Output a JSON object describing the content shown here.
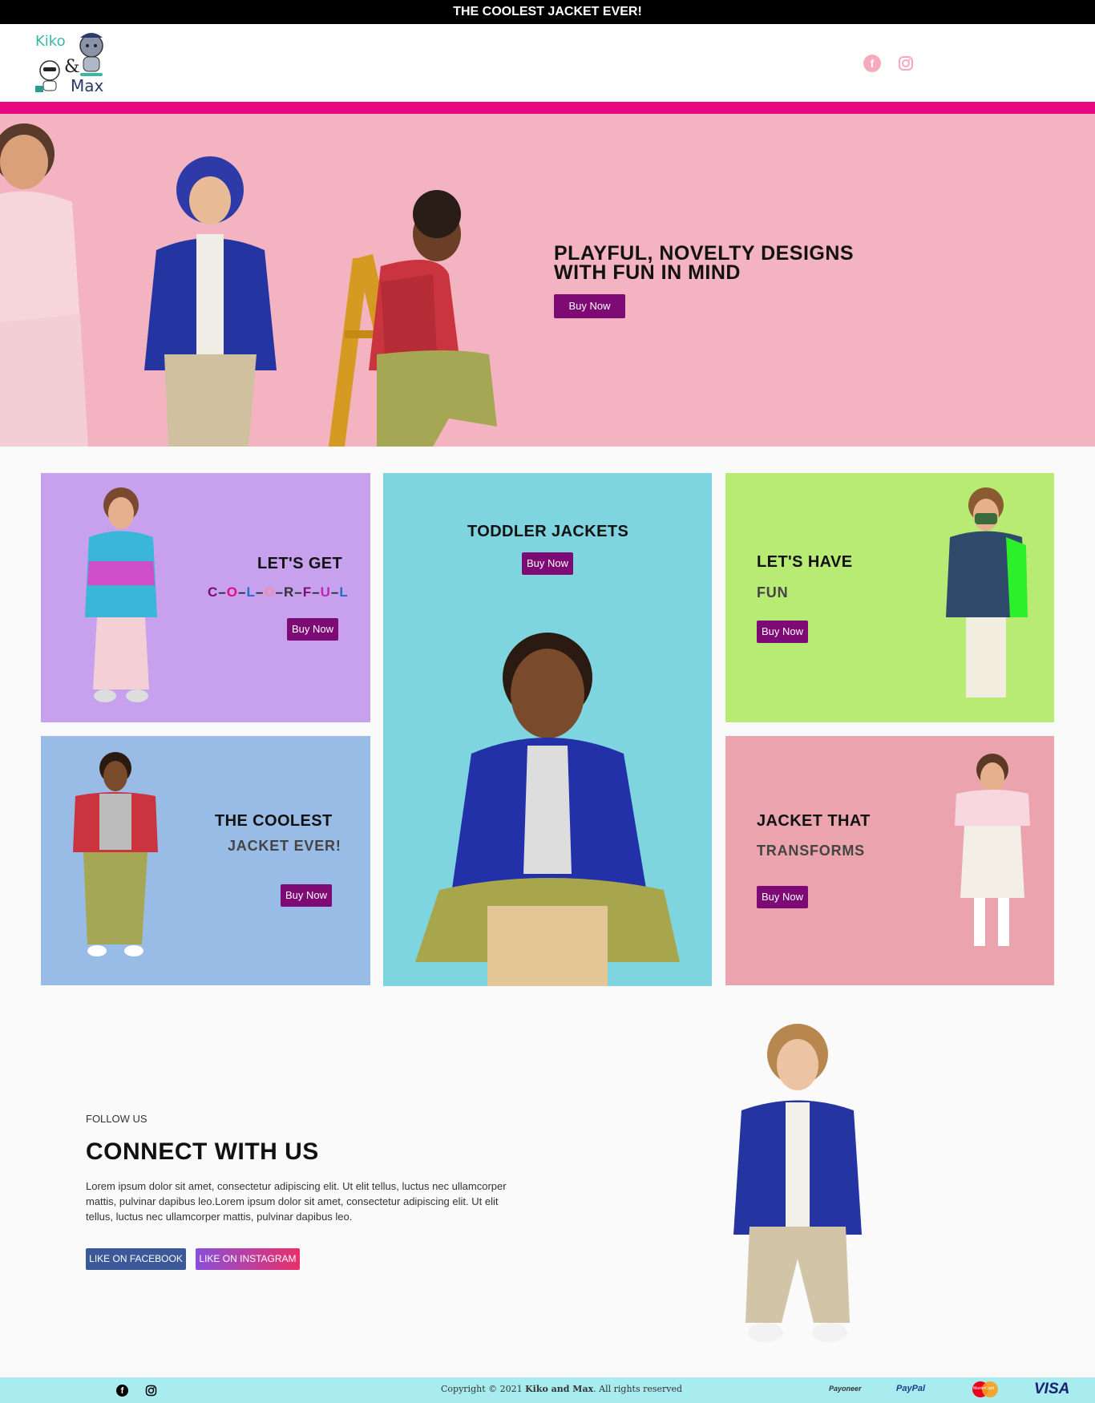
{
  "topbar": {
    "text": "THE COOLEST JACKET EVER!"
  },
  "header": {
    "logo_text": [
      "Kiko",
      "&",
      "Max"
    ],
    "social": [
      {
        "icon": "facebook-icon",
        "color": "#f9a9bd"
      },
      {
        "icon": "instagram-icon",
        "color": "#f9a9bd"
      }
    ]
  },
  "hero": {
    "title_line1": "PLAYFUL, NOVELTY DESIGNS",
    "title_line2": "WITH FUN IN MIND",
    "button": "Buy Now",
    "background": "#f4b3c1"
  },
  "cards": {
    "colorful": {
      "title": "LET'S GET",
      "letters": [
        "C",
        "–",
        "O",
        "–",
        "L",
        "–",
        "O",
        "–",
        "R",
        "–",
        "F",
        "–",
        "U",
        "–",
        "L"
      ],
      "button": "Buy Now",
      "background": "#c7a0ee"
    },
    "toddler": {
      "title": "TODDLER JACKETS",
      "button": "Buy Now",
      "background": "#7ed5df"
    },
    "fun": {
      "title": "LET'S HAVE",
      "subtitle": "FUN",
      "button": "Buy Now",
      "background": "#b8eb73"
    },
    "coolest": {
      "title": "THE COOLEST",
      "subtitle": "JACKET EVER!",
      "button": "Buy Now",
      "background": "#99bce6"
    },
    "transforms": {
      "title": "JACKET THAT",
      "subtitle": "TRANSFORMS",
      "button": "Buy Now",
      "background": "#eba4ad"
    }
  },
  "connect": {
    "eyebrow": "FOLLOW US",
    "title": "CONNECT WITH US",
    "body": "Lorem ipsum dolor sit amet, consectetur adipiscing elit. Ut elit tellus, luctus nec ullamcorper mattis, pulvinar dapibus leo.Lorem ipsum dolor sit amet, consectetur adipiscing elit. Ut elit tellus, luctus nec ullamcorper mattis, pulvinar dapibus leo.",
    "facebook_button": "LIKE ON FACEBOOK",
    "instagram_button": "LIKE ON INSTAGRAM"
  },
  "footer": {
    "copyright_prefix": "Copyright © 2021 ",
    "brand": "Kiko and Max",
    "copyright_suffix": ". All rights reserved",
    "payments": [
      "Payoneer",
      "PayPal",
      "MasterCard",
      "VISA"
    ]
  },
  "colors": {
    "accent": "#7d0a75",
    "brand_pink": "#e6097f",
    "footer": "#a8ecef"
  }
}
